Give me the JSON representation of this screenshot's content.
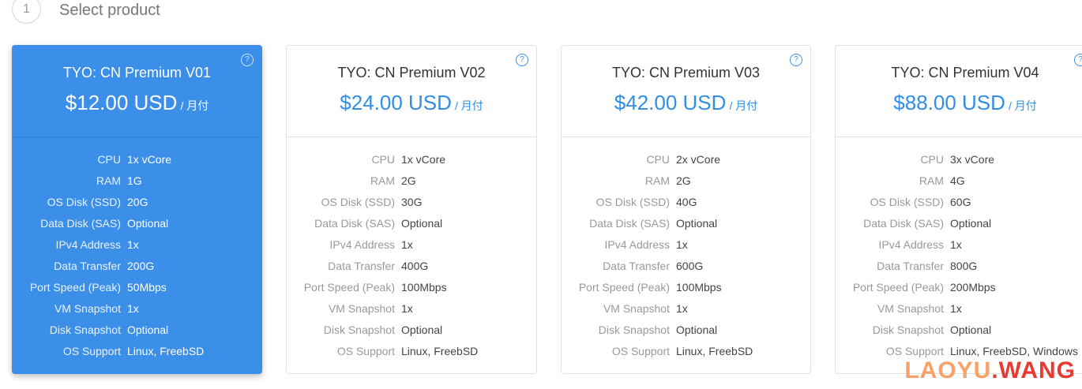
{
  "step": {
    "number": "1",
    "title": "Select product"
  },
  "help_glyph": "?",
  "cards": [
    {
      "name": "TYO: CN Premium V01",
      "price": "$12.00 USD",
      "cycle": "/ 月付",
      "selected": true,
      "specs": [
        {
          "label": "CPU",
          "value": "1x vCore"
        },
        {
          "label": "RAM",
          "value": "1G"
        },
        {
          "label": "OS Disk (SSD)",
          "value": "20G"
        },
        {
          "label": "Data Disk (SAS)",
          "value": "Optional"
        },
        {
          "label": "IPv4 Address",
          "value": "1x"
        },
        {
          "label": "Data Transfer",
          "value": "200G"
        },
        {
          "label": "Port Speed (Peak)",
          "value": "50Mbps"
        },
        {
          "label": "VM Snapshot",
          "value": "1x"
        },
        {
          "label": "Disk Snapshot",
          "value": "Optional"
        },
        {
          "label": "OS Support",
          "value": "Linux, FreebSD"
        }
      ]
    },
    {
      "name": "TYO: CN Premium V02",
      "price": "$24.00 USD",
      "cycle": "/ 月付",
      "selected": false,
      "specs": [
        {
          "label": "CPU",
          "value": "1x vCore"
        },
        {
          "label": "RAM",
          "value": "2G"
        },
        {
          "label": "OS Disk (SSD)",
          "value": "30G"
        },
        {
          "label": "Data Disk (SAS)",
          "value": "Optional"
        },
        {
          "label": "IPv4 Address",
          "value": "1x"
        },
        {
          "label": "Data Transfer",
          "value": "400G"
        },
        {
          "label": "Port Speed (Peak)",
          "value": "100Mbps"
        },
        {
          "label": "VM Snapshot",
          "value": "1x"
        },
        {
          "label": "Disk Snapshot",
          "value": "Optional"
        },
        {
          "label": "OS Support",
          "value": "Linux, FreebSD"
        }
      ]
    },
    {
      "name": "TYO: CN Premium V03",
      "price": "$42.00 USD",
      "cycle": "/ 月付",
      "selected": false,
      "specs": [
        {
          "label": "CPU",
          "value": "2x vCore"
        },
        {
          "label": "RAM",
          "value": "2G"
        },
        {
          "label": "OS Disk (SSD)",
          "value": "40G"
        },
        {
          "label": "Data Disk (SAS)",
          "value": "Optional"
        },
        {
          "label": "IPv4 Address",
          "value": "1x"
        },
        {
          "label": "Data Transfer",
          "value": "600G"
        },
        {
          "label": "Port Speed (Peak)",
          "value": "100Mbps"
        },
        {
          "label": "VM Snapshot",
          "value": "1x"
        },
        {
          "label": "Disk Snapshot",
          "value": "Optional"
        },
        {
          "label": "OS Support",
          "value": "Linux, FreebSD"
        }
      ]
    },
    {
      "name": "TYO: CN Premium V04",
      "price": "$88.00 USD",
      "cycle": "/ 月付",
      "selected": false,
      "specs": [
        {
          "label": "CPU",
          "value": "3x vCore"
        },
        {
          "label": "RAM",
          "value": "4G"
        },
        {
          "label": "OS Disk (SSD)",
          "value": "60G"
        },
        {
          "label": "Data Disk (SAS)",
          "value": "Optional"
        },
        {
          "label": "IPv4 Address",
          "value": "1x"
        },
        {
          "label": "Data Transfer",
          "value": "800G"
        },
        {
          "label": "Port Speed (Peak)",
          "value": "200Mbps"
        },
        {
          "label": "VM Snapshot",
          "value": "1x"
        },
        {
          "label": "Disk Snapshot",
          "value": "Optional"
        },
        {
          "label": "OS Support",
          "value": "Linux, FreebSD, Windows"
        }
      ]
    }
  ],
  "watermark": {
    "part1": "LAOYU",
    "dot": ".",
    "part2": "WANG"
  },
  "colors": {
    "accent": "#3b8fe8",
    "price_blue": "#2f8ee5",
    "label_gray": "#999999"
  }
}
